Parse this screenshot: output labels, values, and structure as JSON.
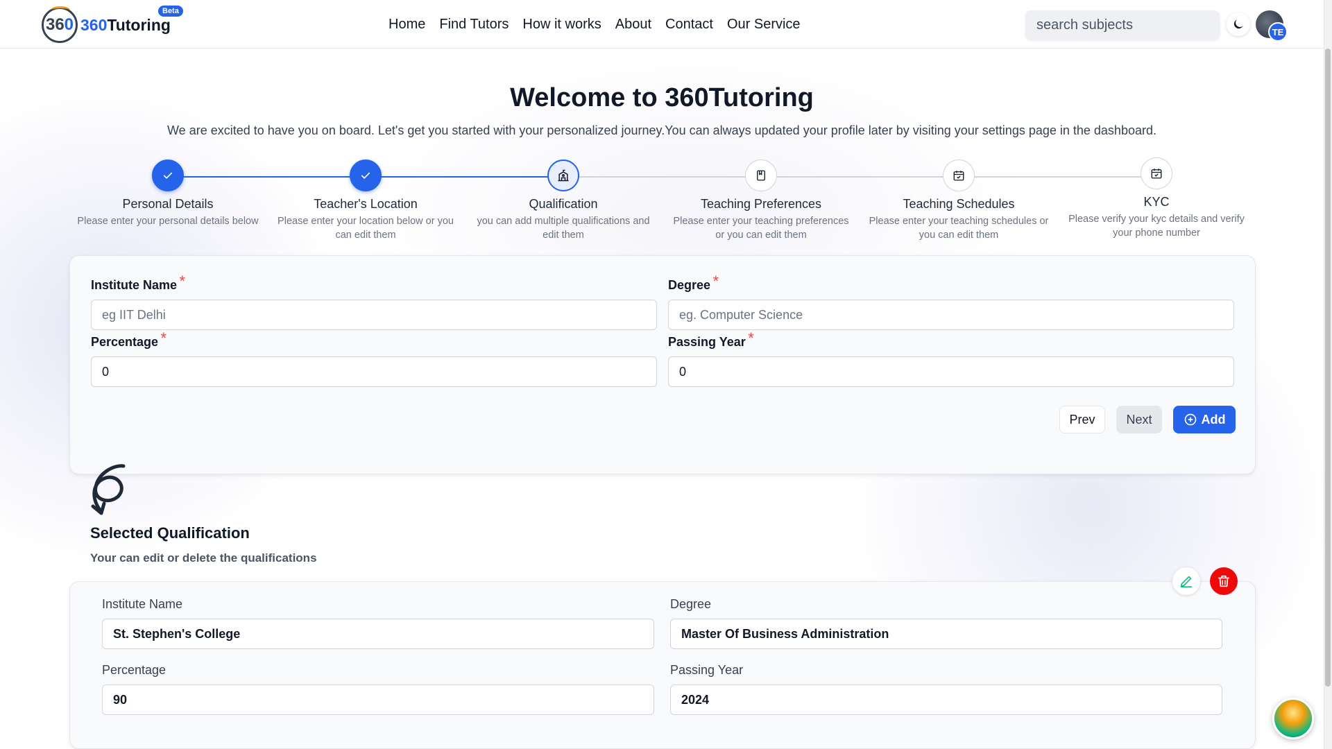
{
  "header": {
    "logo_mark": "36",
    "logo_mark_zero": "0",
    "logo_prefix": "360",
    "logo_suffix": "Tutoring",
    "beta": "Beta",
    "nav": [
      "Home",
      "Find Tutors",
      "How it works",
      "About",
      "Contact",
      "Our Service"
    ],
    "search_placeholder": "search subjects",
    "avatar_initials": "TE",
    "icons": {
      "theme": "moon-icon",
      "avatar": "user-avatar"
    }
  },
  "page": {
    "title": "Welcome to 360Tutoring",
    "subtitle": "We are excited to have you on board. Let's get you started with your personalized journey.You can always updated your profile later by visiting your settings page in the dashboard."
  },
  "stepper": {
    "steps": [
      {
        "title": "Personal Details",
        "desc": "Please enter your personal details below",
        "status": "done",
        "icon": "check-icon"
      },
      {
        "title": "Teacher's Location",
        "desc": "Please enter your location below or you can edit them",
        "status": "done",
        "icon": "check-icon"
      },
      {
        "title": "Qualification",
        "desc": "you can add multiple qualifications and edit them",
        "status": "active",
        "icon": "school-icon"
      },
      {
        "title": "Teaching Preferences",
        "desc": "Please enter your teaching preferences or you can edit them",
        "status": "pending",
        "icon": "book-icon"
      },
      {
        "title": "Teaching Schedules",
        "desc": "Please enter your teaching schedules or you can edit them",
        "status": "pending",
        "icon": "calendar-check-icon"
      },
      {
        "title": "KYC",
        "desc": "Please verify your kyc details and verify your phone number",
        "status": "pending",
        "icon": "calendar-check-icon"
      }
    ]
  },
  "form": {
    "institute_label": "Institute Name",
    "institute_placeholder": "eg IIT Delhi",
    "degree_label": "Degree",
    "degree_placeholder": "eg. Computer Science",
    "percentage_label": "Percentage",
    "percentage_value": "0",
    "year_label": "Passing Year",
    "year_value": "0",
    "required_mark": "*",
    "prev": "Prev",
    "next": "Next",
    "add": "Add"
  },
  "selected": {
    "title": "Selected Qualification",
    "subtitle": "Your can edit or delete the qualifications",
    "items": [
      {
        "institute_label": "Institute Name",
        "institute": "St. Stephen's College",
        "degree_label": "Degree",
        "degree": "Master Of Business Administration",
        "percentage_label": "Percentage",
        "percentage": "90",
        "year_label": "Passing Year",
        "year": "2024"
      }
    ]
  },
  "colors": {
    "accent": "#2563eb",
    "danger": "#ef0a0a",
    "required": "#ef4444"
  }
}
